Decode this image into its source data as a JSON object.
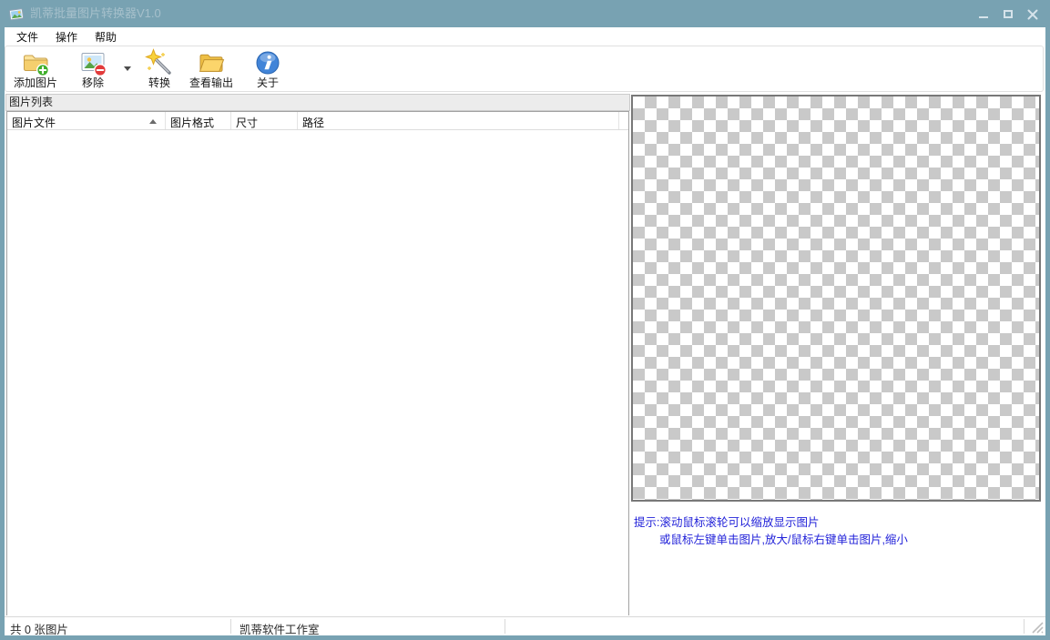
{
  "window": {
    "title": "凯蒂批量图片转换器V1.0",
    "controls": [
      "minimize",
      "maximize",
      "close"
    ]
  },
  "menu": {
    "items": [
      {
        "label": "文件"
      },
      {
        "label": "操作"
      },
      {
        "label": "帮助"
      }
    ]
  },
  "toolbar": {
    "buttons": [
      {
        "label": "添加图片",
        "icon": "add-image-folder-icon"
      },
      {
        "label": "移除",
        "icon": "remove-image-icon"
      },
      {
        "label": "转换",
        "icon": "magic-wand-icon"
      },
      {
        "label": "查看输出",
        "icon": "open-folder-icon"
      },
      {
        "label": "关于",
        "icon": "info-icon"
      }
    ],
    "dropdown_icon": "chevron-down-icon"
  },
  "image_list": {
    "caption": "图片列表",
    "columns": [
      {
        "label": "图片文件",
        "sort": "asc"
      },
      {
        "label": "图片格式",
        "sort": null
      },
      {
        "label": "尺寸",
        "sort": null
      },
      {
        "label": "路径",
        "sort": null
      }
    ],
    "rows": []
  },
  "preview": {
    "content": "transparency-checkerboard",
    "hints": [
      "提示:滚动鼠标滚轮可以缩放显示图片",
      "或鼠标左键单击图片,放大/鼠标右键单击图片,缩小"
    ]
  },
  "statusbar": {
    "image_count": "共 0 张图片",
    "studio": "凯蒂软件工作室"
  },
  "colors": {
    "titlebar": "#78a2b2",
    "hint_text": "#2323d9",
    "checker_gray": "#c9c9c9",
    "preview_border": "#787878",
    "folder_yellow": "#f5cf6e",
    "add_green": "#3fae2a",
    "remove_red": "#e23b3b",
    "info_blue": "#4184d8",
    "wand_star_yellow": "#f8d23c"
  }
}
